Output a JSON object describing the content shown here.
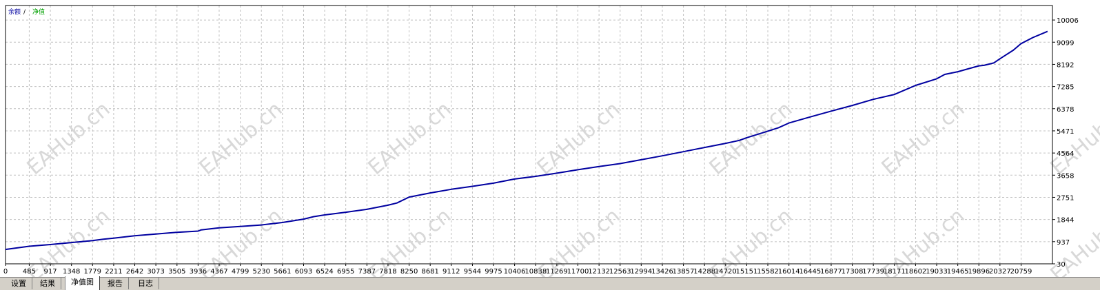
{
  "chart_data": {
    "type": "line",
    "legend": [
      {
        "label": "余额",
        "color": "#0000a0"
      },
      {
        "label": "/",
        "color": "#000000"
      },
      {
        "label": "净值",
        "color": "#00a000"
      }
    ],
    "x_ticks": [
      0,
      485,
      917,
      1348,
      1779,
      2211,
      2642,
      3073,
      3505,
      3936,
      4367,
      4799,
      5230,
      5661,
      6093,
      6524,
      6955,
      7387,
      7818,
      8250,
      8681,
      9112,
      9544,
      9975,
      10406,
      10838,
      11269,
      11700,
      12132,
      12563,
      12994,
      13426,
      13857,
      14288,
      14720,
      15151,
      15582,
      16014,
      16445,
      16877,
      17308,
      17739,
      18171,
      18602,
      19033,
      19465,
      19896,
      20327,
      20759
    ],
    "y_ticks": [
      30,
      937,
      1844,
      2751,
      3658,
      4564,
      5471,
      6378,
      7285,
      8192,
      9099,
      10006
    ],
    "xlim": [
      0,
      21400
    ],
    "ylim": [
      30,
      10600
    ],
    "grid": true,
    "series": [
      {
        "color": "#0000a0",
        "x": [
          0,
          485,
          917,
          1348,
          1779,
          2000,
          2211,
          2642,
          3073,
          3505,
          3936,
          4000,
          4367,
          4799,
          5230,
          5661,
          6093,
          6300,
          6524,
          6955,
          7387,
          7818,
          8000,
          8250,
          8681,
          9112,
          9544,
          9975,
          10406,
          10838,
          11269,
          11700,
          12132,
          12563,
          12994,
          13426,
          13857,
          14288,
          14720,
          15000,
          15151,
          15582,
          15800,
          16014,
          16445,
          16877,
          17308,
          17739,
          18171,
          18602,
          19033,
          19200,
          19465,
          19896,
          20000,
          20200,
          20327,
          20600,
          20759,
          21000,
          21300
        ],
        "y": [
          620,
          750,
          820,
          900,
          980,
          1040,
          1080,
          1180,
          1250,
          1320,
          1370,
          1420,
          1500,
          1560,
          1620,
          1720,
          1860,
          1960,
          2030,
          2140,
          2260,
          2430,
          2520,
          2760,
          2930,
          3080,
          3200,
          3330,
          3500,
          3610,
          3740,
          3880,
          4010,
          4130,
          4290,
          4450,
          4620,
          4790,
          4960,
          5080,
          5190,
          5460,
          5600,
          5790,
          6040,
          6280,
          6510,
          6760,
          6960,
          7330,
          7600,
          7780,
          7890,
          8130,
          8150,
          8250,
          8420,
          8770,
          9040,
          9290,
          9540
        ]
      }
    ]
  },
  "tabs": [
    {
      "label": "设置"
    },
    {
      "label": "结果"
    },
    {
      "label": "净值图"
    },
    {
      "label": "报告"
    },
    {
      "label": "日志"
    }
  ],
  "watermark": "EAHub.cn",
  "colors": {
    "line": "#0000a0",
    "grid": "#c0c0c0",
    "frame": "#000000"
  }
}
